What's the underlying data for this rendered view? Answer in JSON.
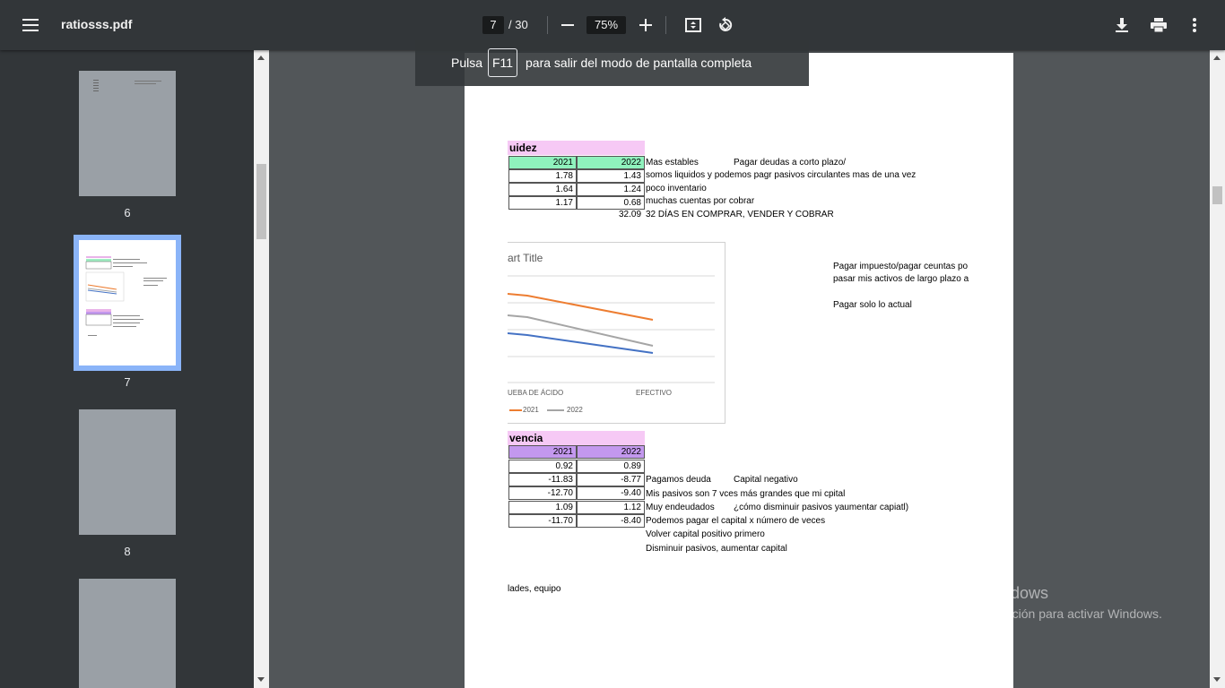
{
  "toolbar": {
    "title": "ratiosss.pdf",
    "current_page": "7",
    "separator": "/",
    "total_pages": "30",
    "zoom": "75%",
    "icons": {
      "menu": "menu-icon",
      "zoom_out": "minus-icon",
      "zoom_in": "plus-icon",
      "fit": "fit-page-icon",
      "rotate": "rotate-icon",
      "download": "download-icon",
      "print": "print-icon",
      "more": "more-vert-icon"
    }
  },
  "toast": {
    "before": "Pulsa",
    "key": "F11",
    "after": "para salir del modo de pantalla completa"
  },
  "thumbnails": [
    "6",
    "7",
    "8"
  ],
  "page": {
    "table1": {
      "title": "uidez",
      "headers": [
        "2021",
        "2022"
      ],
      "rows": [
        [
          "1.78",
          "1.43"
        ],
        [
          "1.64",
          "1.24"
        ],
        [
          "1.17",
          "0.68"
        ]
      ],
      "extra_value": "32.09"
    },
    "notes1": [
      "Mas estables",
      "Pagar deudas a corto plazo/",
      "somos liquidos y podemos pagr pasivos circulantes mas de una vez",
      "poco inventario",
      "muchas cuentas por cobrar",
      "32 DÍAS EN COMPRAR, VENDER Y COBRAR"
    ],
    "side_notes": [
      "Pagar impuesto/pagar ceuntas po",
      "pasar mis activos de largo plazo a",
      "Pagar solo lo actual"
    ],
    "table2": {
      "title": "vencia",
      "headers": [
        "2021",
        "2022"
      ],
      "rows": [
        [
          "0.92",
          "0.89"
        ],
        [
          "-11.83",
          "-8.77"
        ],
        [
          "-12.70",
          "-9.40"
        ],
        [
          "1.09",
          "1.12"
        ],
        [
          "-11.70",
          "-8.40"
        ]
      ]
    },
    "notes2": [
      "Pagamos deuda",
      "Capital negativo",
      "Mis pasivos son 7 vces más grandes que mi cpital",
      "Muy endeudados",
      "¿cómo disminuir pasivos yaumentar capiatl)",
      "Podemos pagar el capital x número de veces",
      "Volver capital positivo primero",
      "Disminuir pasivos, aumentar capital"
    ],
    "footer_text": "lades, equipo"
  },
  "chart_data": {
    "type": "line",
    "title": "art Title",
    "categories": [
      "UEBA DE ÁCIDO",
      "EFECTIVO"
    ],
    "series": [
      {
        "name": "2021",
        "color": "#ed7d31"
      },
      {
        "name": "2022",
        "color": "#a5a5a5"
      }
    ],
    "unlabeled_series_color": "#4472c4",
    "legend": "bottom"
  },
  "watermark": {
    "line1": "Activar Windows",
    "line2": "Ve a Configuración para activar Windows."
  }
}
